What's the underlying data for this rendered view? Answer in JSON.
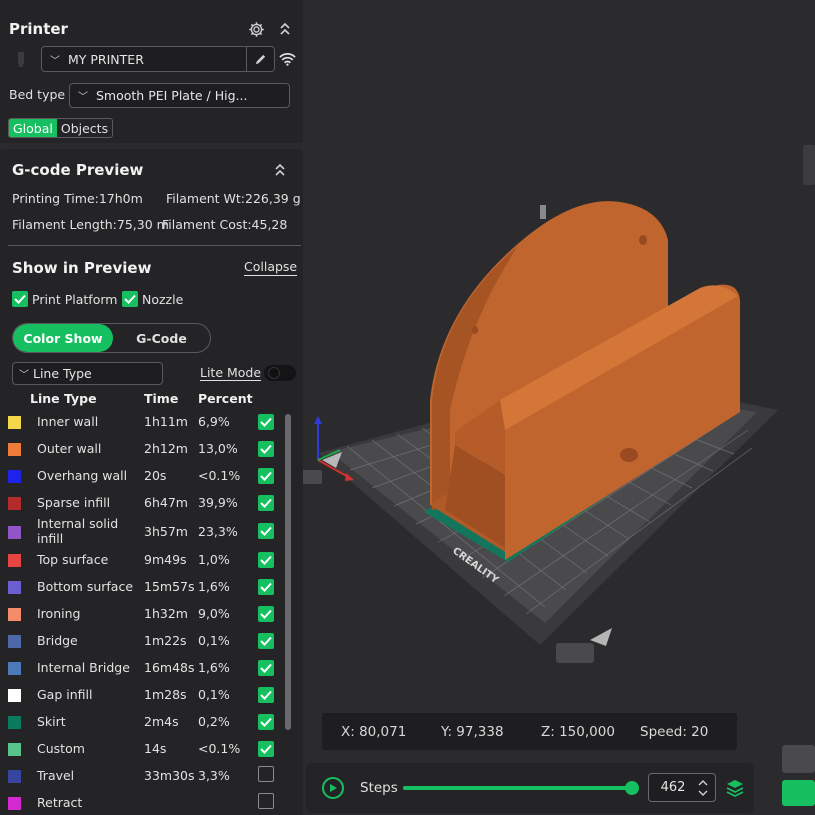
{
  "printer": {
    "title": "Printer",
    "name": "MY PRINTER",
    "bed_type_label": "Bed type",
    "bed_type_value": "Smooth PEI Plate / Hig...",
    "tabs": [
      "Global",
      "Objects"
    ]
  },
  "gcode": {
    "title": "G-code Preview",
    "printing_time": "Printing Time:17h0m",
    "filament_wt": "Filament Wt:226,39 g",
    "filament_length": "Filament Length:75,30 m",
    "filament_cost": "Filament Cost:45,28"
  },
  "show": {
    "title": "Show in Preview",
    "collapse": "Collapse",
    "print_platform": "Print Platform",
    "nozzle": "Nozzle",
    "color_show": "Color Show",
    "gcode_tab": "G-Code",
    "line_type_select": "Line Type",
    "lite_mode": "Lite Mode"
  },
  "table": {
    "headers": [
      "Line Type",
      "Time",
      "Percent"
    ],
    "rows": [
      {
        "name": "Inner wall",
        "time": "1h11m",
        "percent": "6,9%",
        "color": "#f5d84a",
        "checked": true
      },
      {
        "name": "Outer wall",
        "time": "2h12m",
        "percent": "13,0%",
        "color": "#f07c3c",
        "checked": true
      },
      {
        "name": "Overhang wall",
        "time": "20s",
        "percent": "<0.1%",
        "color": "#1f22e8",
        "checked": true
      },
      {
        "name": "Sparse infill",
        "time": "6h47m",
        "percent": "39,9%",
        "color": "#b22c2c",
        "checked": true
      },
      {
        "name": "Internal solid infill",
        "time": "3h57m",
        "percent": "23,3%",
        "color": "#9255c8",
        "checked": true
      },
      {
        "name": "Top surface",
        "time": "9m49s",
        "percent": "1,0%",
        "color": "#e84444",
        "checked": true
      },
      {
        "name": "Bottom surface",
        "time": "15m57s",
        "percent": "1,6%",
        "color": "#6a5ed0",
        "checked": true
      },
      {
        "name": "Ironing",
        "time": "1h32m",
        "percent": "9,0%",
        "color": "#f48c6a",
        "checked": true
      },
      {
        "name": "Bridge",
        "time": "1m22s",
        "percent": "0,1%",
        "color": "#4d68a8",
        "checked": true
      },
      {
        "name": "Internal Bridge",
        "time": "16m48s",
        "percent": "1,6%",
        "color": "#4e79b8",
        "checked": true
      },
      {
        "name": "Gap infill",
        "time": "1m28s",
        "percent": "0,1%",
        "color": "#ffffff",
        "checked": true
      },
      {
        "name": "Skirt",
        "time": "2m4s",
        "percent": "0,2%",
        "color": "#0c7a5e",
        "checked": true
      },
      {
        "name": "Custom",
        "time": "14s",
        "percent": "<0.1%",
        "color": "#58c48a",
        "checked": true
      },
      {
        "name": "Travel",
        "time": "33m30s",
        "percent": "3,3%",
        "color": "#3845a0",
        "checked": false
      },
      {
        "name": "Retract",
        "time": "",
        "percent": "",
        "color": "#d22ad0",
        "checked": false
      }
    ]
  },
  "coords": {
    "x": "X: 80,071",
    "y": "Y: 97,338",
    "z": "Z: 150,000",
    "speed": "Speed: 20"
  },
  "steps": {
    "label": "Steps",
    "value": "462",
    "progress": 1.0
  },
  "bed_brand": "CREALITY",
  "colors": {
    "accent": "#16c060",
    "model": "#c0652d",
    "bed": "#4a4a4d"
  }
}
